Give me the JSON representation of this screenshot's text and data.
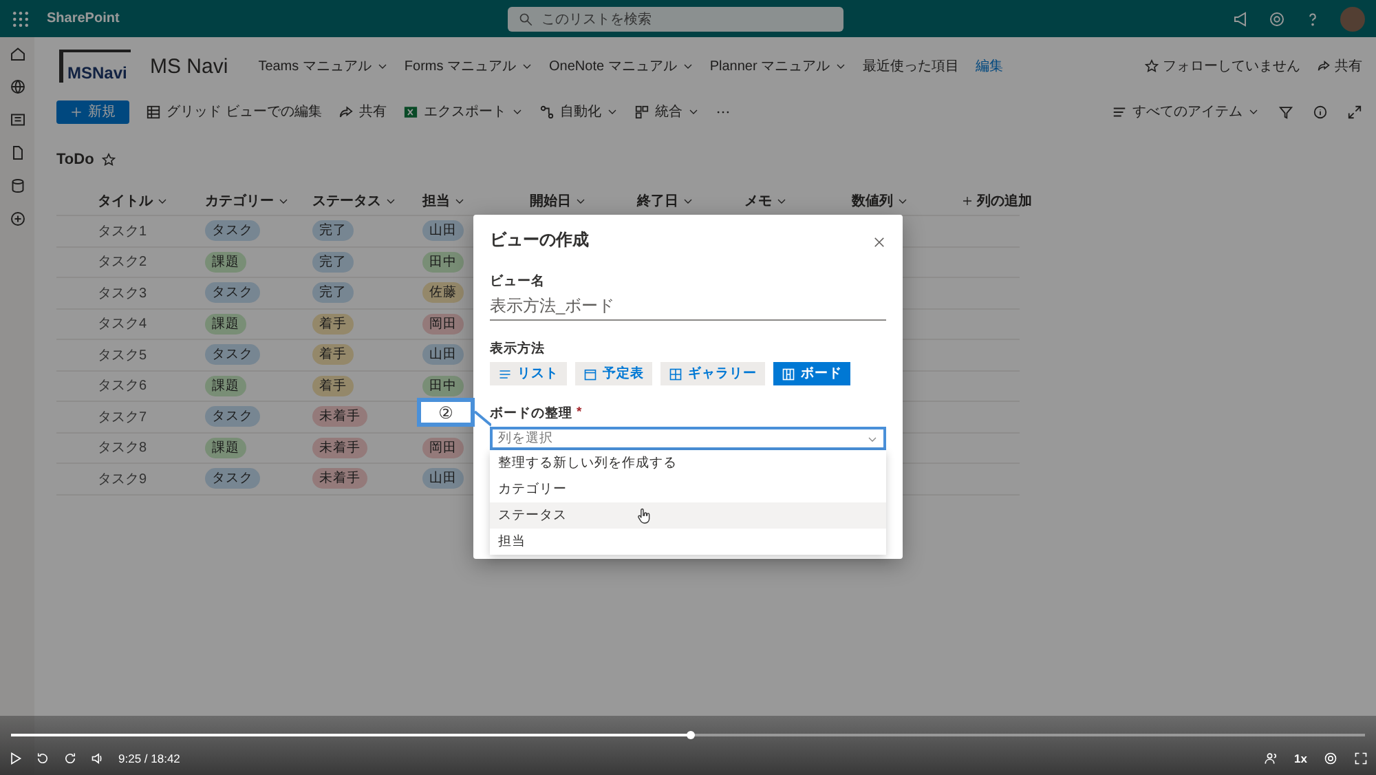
{
  "suite_bar": {
    "app_name": "SharePoint",
    "search": {
      "placeholder": "このリストを検索"
    }
  },
  "site_header": {
    "logo_text": "MSNavi",
    "title": "MS Navi",
    "nav": [
      {
        "label": "Teams マニュアル",
        "kind": "menu"
      },
      {
        "label": "Forms マニュアル",
        "kind": "menu"
      },
      {
        "label": "OneNote マニュアル",
        "kind": "menu"
      },
      {
        "label": "Planner マニュアル",
        "kind": "menu"
      },
      {
        "label": "最近使った項目",
        "kind": "plain"
      },
      {
        "label": "編集",
        "kind": "link"
      }
    ],
    "follow": "フォローしていません",
    "share": "共有"
  },
  "command_bar": {
    "new": "新規",
    "items": [
      {
        "label": "グリッド ビューでの編集",
        "kind": "grid",
        "dropdown": false
      },
      {
        "label": "共有",
        "kind": "share",
        "dropdown": false
      },
      {
        "label": "エクスポート",
        "kind": "excel",
        "dropdown": true
      },
      {
        "label": "自動化",
        "kind": "flow",
        "dropdown": true
      },
      {
        "label": "統合",
        "kind": "apps",
        "dropdown": true
      }
    ],
    "view": "すべてのアイテム"
  },
  "list": {
    "title": "ToDo",
    "favorite": false
  },
  "table": {
    "columns": [
      "タイトル",
      "カテゴリー",
      "ステータス",
      "担当",
      "開始日",
      "終了日",
      "メモ",
      "数値列"
    ],
    "add_column": "列の追加",
    "rows": [
      {
        "title": "タスク1",
        "category": {
          "text": "タスク",
          "color": "#778692"
        },
        "status": {
          "text": "完了",
          "color": "#778692"
        },
        "assignee": {
          "text": "山田",
          "color": "#778692"
        }
      },
      {
        "title": "タスク2",
        "category": {
          "text": "課題",
          "color": "#798e76"
        },
        "status": {
          "text": "完了",
          "color": "#778692"
        },
        "assignee": {
          "text": "田中",
          "color": "#798e76"
        }
      },
      {
        "title": "タスク3",
        "category": {
          "text": "タスク",
          "color": "#778692"
        },
        "status": {
          "text": "完了",
          "color": "#778692"
        },
        "assignee": {
          "text": "佐藤",
          "color": "#94886a"
        }
      },
      {
        "title": "タスク4",
        "category": {
          "text": "課題",
          "color": "#798e76"
        },
        "status": {
          "text": "着手",
          "color": "#94886a"
        },
        "assignee": {
          "text": "岡田",
          "color": "#947a7a"
        }
      },
      {
        "title": "タスク5",
        "category": {
          "text": "タスク",
          "color": "#778692"
        },
        "status": {
          "text": "着手",
          "color": "#94886a"
        },
        "assignee": {
          "text": "山田",
          "color": "#778692"
        }
      },
      {
        "title": "タスク6",
        "category": {
          "text": "課題",
          "color": "#798e76"
        },
        "status": {
          "text": "着手",
          "color": "#94886a"
        },
        "assignee": {
          "text": "田中",
          "color": "#798e76"
        }
      },
      {
        "title": "タスク7",
        "category": {
          "text": "タスク",
          "color": "#778692"
        },
        "status": {
          "text": "未着手",
          "color": "#947a7a"
        }
      },
      {
        "title": "タスク8",
        "category": {
          "text": "課題",
          "color": "#798e76"
        },
        "status": {
          "text": "未着手",
          "color": "#947a7a"
        },
        "assignee": {
          "text": "岡田",
          "color": "#947a7a"
        }
      },
      {
        "title": "タスク9",
        "category": {
          "text": "タスク",
          "color": "#778692"
        },
        "status": {
          "text": "未着手",
          "color": "#947a7a"
        },
        "assignee": {
          "text": "山田",
          "color": "#778692"
        }
      }
    ]
  },
  "dialog": {
    "title": "ビューの作成",
    "name_label": "ビュー名",
    "name_value": "表示方法_ボード",
    "layout_label": "表示方法",
    "layouts": [
      {
        "label": "リスト",
        "kind": "list",
        "selected": false
      },
      {
        "label": "予定表",
        "kind": "calendar",
        "selected": false
      },
      {
        "label": "ギャラリー",
        "kind": "gallery",
        "selected": false
      },
      {
        "label": "ボード",
        "kind": "board",
        "selected": true
      }
    ],
    "organize_label": "ボードの整理",
    "required_mark": "*",
    "organize_placeholder": "列を選択",
    "options": [
      {
        "label": "整理する新しい列を作成する",
        "hovered": false
      },
      {
        "label": "カテゴリー",
        "hovered": false
      },
      {
        "label": "ステータス",
        "hovered": true
      },
      {
        "label": "担当",
        "hovered": false
      }
    ]
  },
  "callout": {
    "text": "②"
  },
  "player": {
    "level": 0.502,
    "playing": false,
    "time": "9:25 / 18:42",
    "speed": "1x"
  }
}
